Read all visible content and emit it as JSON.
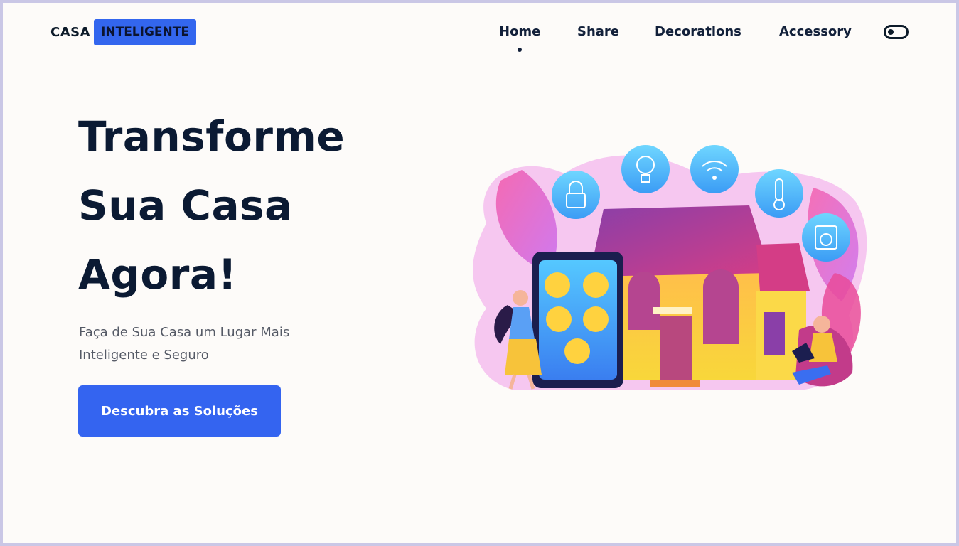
{
  "logo": {
    "first": "CASA",
    "second": "INTELIGENTE"
  },
  "nav": {
    "items": [
      {
        "label": "Home",
        "active": true
      },
      {
        "label": "Share",
        "active": false
      },
      {
        "label": "Decorations",
        "active": false
      },
      {
        "label": "Accessory",
        "active": false
      }
    ],
    "theme_toggle_icon": "toggle-icon"
  },
  "hero": {
    "title_lines": [
      "Transforme",
      "Sua Casa",
      "Agora!"
    ],
    "subtitle_lines": [
      "Faça de Sua Casa um Lugar Mais",
      "Inteligente e Seguro"
    ],
    "cta_label": "Descubra as Soluções"
  },
  "illustration": {
    "subject": "smart-home-illustration",
    "icons": [
      "lock-icon",
      "lightbulb-icon",
      "wifi-icon",
      "thermometer-icon",
      "washing-machine-icon"
    ]
  },
  "colors": {
    "accent": "#3464f0",
    "text_dark": "#0b1a33",
    "background": "#fdfbf9",
    "frame_border": "#cac7e6"
  }
}
